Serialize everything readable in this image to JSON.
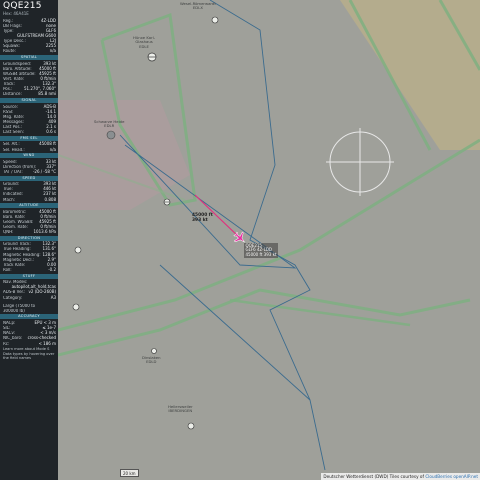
{
  "aircraft": {
    "callsign": "QQE215",
    "hex_line": "Hex: 46A41E"
  },
  "sections": [
    {
      "title": "",
      "rows": [
        {
          "k": "Reg.:",
          "v": "4Z-LDD"
        },
        {
          "k": "DB Flags:",
          "v": "none"
        },
        {
          "k": "Type:",
          "v": "GLF6"
        },
        {
          "k": "",
          "v": "GULFSTREAM G600"
        },
        {
          "k": "Type Desc.:",
          "v": "L2J"
        },
        {
          "k": "Squawk:",
          "v": "2255"
        },
        {
          "k": "Route:",
          "v": "n/a"
        }
      ]
    },
    {
      "title": "SPATIAL",
      "rows": [
        {
          "k": "Groundspeed:",
          "v": "393 kt"
        },
        {
          "k": "Baro. Altitude:",
          "v": "45000 ft"
        },
        {
          "k": "WGS84 altitude:",
          "v": "45925 ft"
        },
        {
          "k": "Vert. Rate:",
          "v": "0 ft/min"
        },
        {
          "k": "Track:",
          "v": "132.3°"
        },
        {
          "k": "Pos.:",
          "v": "51.270°, 7.060°"
        },
        {
          "k": "Distance:",
          "v": "85.8 nmi"
        }
      ]
    },
    {
      "title": "SIGNAL",
      "rows": [
        {
          "k": "Source:",
          "v": "ADS-B"
        },
        {
          "k": "RSSI:",
          "v": "-14.1"
        },
        {
          "k": "Msg. Rate:",
          "v": "14.0"
        },
        {
          "k": "Messages:",
          "v": "409"
        },
        {
          "k": "Last Pos.:",
          "v": "2.1 s"
        },
        {
          "k": "Last Seen:",
          "v": "0.6 s"
        }
      ]
    },
    {
      "title": "FMS SEL",
      "rows": [
        {
          "k": "Sel. Alt.:",
          "v": "45008 ft"
        },
        {
          "k": "Sel. Head.:",
          "v": "n/a"
        }
      ]
    },
    {
      "title": "WIND",
      "rows": [
        {
          "k": "Speed:",
          "v": "33 kt"
        },
        {
          "k": "Direction (from):",
          "v": "337°"
        },
        {
          "k": "TAT / OAT:",
          "v": "-26 / -58 °C"
        }
      ]
    },
    {
      "title": "SPEED",
      "rows": [
        {
          "k": "Ground:",
          "v": "393 kt"
        },
        {
          "k": "True:",
          "v": "446 kt"
        },
        {
          "k": "Indicated:",
          "v": "237 kt"
        },
        {
          "k": "Mach:",
          "v": "0.808"
        }
      ]
    },
    {
      "title": "ALTITUDE",
      "rows": [
        {
          "k": "Barometric:",
          "v": "45000 ft"
        },
        {
          "k": "Baro. Rate:",
          "v": "0 ft/min"
        },
        {
          "k": "Geom. WGS84:",
          "v": "45925 ft"
        },
        {
          "k": "Geom. Rate:",
          "v": "0 ft/min"
        },
        {
          "k": "QNH:",
          "v": "1013.6 hPa"
        }
      ]
    },
    {
      "title": "DIRECTION",
      "rows": [
        {
          "k": "Ground Track:",
          "v": "132.3°"
        },
        {
          "k": "True Heading:",
          "v": "131.6°"
        },
        {
          "k": "Magnetic Heading:",
          "v": "128.6°"
        },
        {
          "k": "Magnetic Decl.:",
          "v": "2.9°"
        },
        {
          "k": "Track Rate:",
          "v": "0.00"
        },
        {
          "k": "Roll:",
          "v": "-0.2"
        }
      ]
    },
    {
      "title": "STUFF",
      "rows": [
        {
          "k": "Nav. Modes:",
          "v": ""
        },
        {
          "k": "",
          "v": "autopilot,alt_hold,tcas"
        },
        {
          "k": "ADS-B Ver.:",
          "v": "v2 (DO-260B)"
        },
        {
          "k": "Category:",
          "v": "A3"
        }
      ]
    },
    {
      "title": "",
      "rows": [
        {
          "k": "Large (75000 to",
          "v": ""
        },
        {
          "k": "300000 lb)",
          "v": ""
        }
      ]
    },
    {
      "title": "ACCURACY",
      "rows": [
        {
          "k": "NACp:",
          "v": "EPU < 3 m"
        },
        {
          "k": "SIL:",
          "v": "≤ 1e-7"
        },
        {
          "k": "NACv:",
          "v": "< 3 m/s"
        },
        {
          "k": "NIC_baro:",
          "v": "cross-checked"
        },
        {
          "k": "Rc:",
          "v": "< 186 m"
        }
      ]
    }
  ],
  "footer_note": "Learn more about Mode S Data types by hovering over the field names",
  "map": {
    "aircraft_label_1": [
      "QQE215",
      "GLF6  4Z-LDD",
      "45000 ft  393 kt"
    ],
    "aircraft_label_2": [
      "45000 ft",
      "393 kt"
    ],
    "attribution_text": "Deutscher Wetterdienst (DWD) Tiles courtesy of",
    "attribution_link1": "CloudBerries",
    "attribution_link2": "openAIP.net",
    "scale_text": "20 km",
    "place_labels": [
      {
        "text": "Wesel-Römerwardt\nEDLX"
      },
      {
        "text": "Hünxe Karl-\nGlashaus\nEDLE"
      },
      {
        "text": "Schwarze Heide\nEDLR"
      },
      {
        "text": "Dinslaken\nEDLD"
      },
      {
        "text": "Hellersweiler\nIBERDINGEN"
      }
    ]
  }
}
